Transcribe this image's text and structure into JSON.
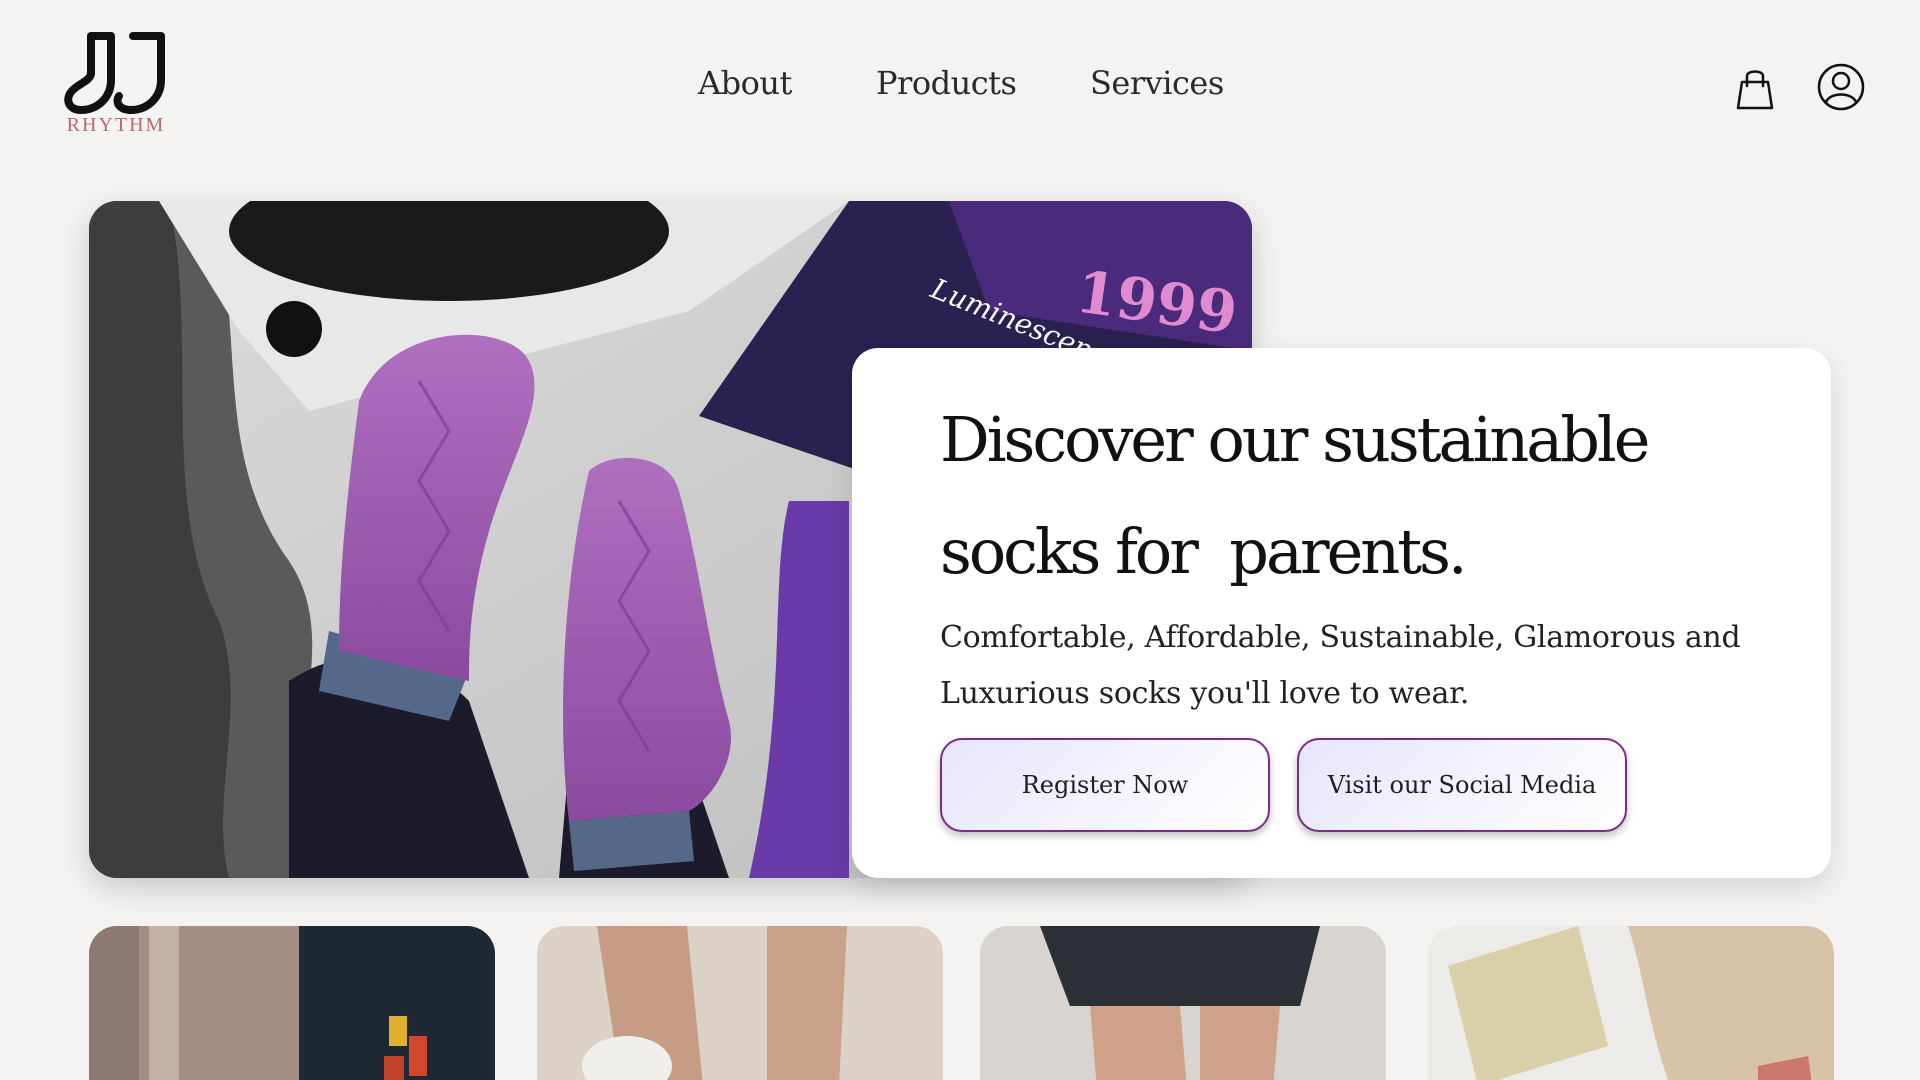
{
  "brand": {
    "name": "RHYTHM",
    "logo_icon": "socks-logo-icon",
    "color": "#b86a6a"
  },
  "nav": {
    "items": [
      {
        "label": "About"
      },
      {
        "label": "Products"
      },
      {
        "label": "Services"
      }
    ]
  },
  "header_icons": {
    "cart": "shopping-bag-icon",
    "account": "user-icon"
  },
  "hero": {
    "title_line1": "Discover our sustainable",
    "title_line2": "socks for  parents.",
    "subtitle_line1": "Comfortable, Affordable, Sustainable, Glamorous and",
    "subtitle_line2": "Luxurious socks you'll love to wear.",
    "primary_button": "Register Now",
    "secondary_button": "Visit our Social Media",
    "button_border_color": "#7a2c86",
    "photo_record_text": "Luminescen",
    "photo_poster_text": "1999"
  },
  "thumbnails": [
    {
      "name": "thumbnail-bookshelf"
    },
    {
      "name": "thumbnail-legs-shoes"
    },
    {
      "name": "thumbnail-skirt-legs"
    },
    {
      "name": "thumbnail-bed-book"
    }
  ],
  "colors": {
    "background": "#f4f3f1",
    "card": "#ffffff",
    "accent": "#7a2c86"
  }
}
